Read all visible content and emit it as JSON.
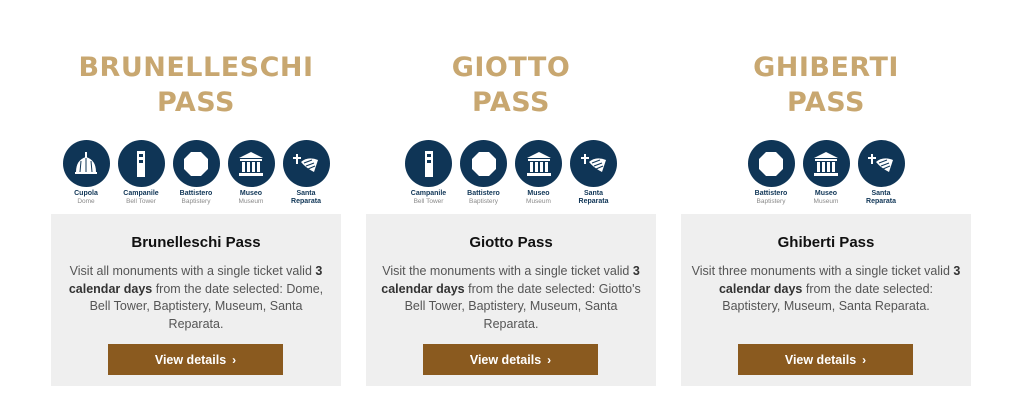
{
  "passes": [
    {
      "hero_title_line1": "BRUNELLESCHI",
      "hero_title_line2": "PASS",
      "monuments": [
        {
          "icon": "dome-icon",
          "name": "Cupola",
          "sub": "Dome"
        },
        {
          "icon": "bell-tower-icon",
          "name": "Campanile",
          "sub": "Bell Tower"
        },
        {
          "icon": "baptistery-icon",
          "name": "Battistero",
          "sub": "Baptistery"
        },
        {
          "icon": "museum-icon",
          "name": "Museo",
          "sub": "Museum"
        },
        {
          "icon": "santa-reparata-icon",
          "name": "Santa",
          "sub": "Reparata"
        }
      ],
      "title": "Brunelleschi Pass",
      "desc_pre": "Visit all monuments with a single ticket valid ",
      "desc_bold": "3 calendar days",
      "desc_post": " from the date selected: Dome, Bell Tower, Baptistery, Museum, Santa Reparata.",
      "button": "View details"
    },
    {
      "hero_title_line1": "GIOTTO",
      "hero_title_line2": "PASS",
      "monuments": [
        {
          "icon": "bell-tower-icon",
          "name": "Campanile",
          "sub": "Bell Tower"
        },
        {
          "icon": "baptistery-icon",
          "name": "Battistero",
          "sub": "Baptistery"
        },
        {
          "icon": "museum-icon",
          "name": "Museo",
          "sub": "Museum"
        },
        {
          "icon": "santa-reparata-icon",
          "name": "Santa",
          "sub": "Reparata"
        }
      ],
      "title": "Giotto Pass",
      "desc_pre": "Visit the monuments with a single ticket valid ",
      "desc_bold": "3 calendar days",
      "desc_post": " from the date selected: Giotto's Bell Tower, Baptistery, Museum, Santa Reparata.",
      "button": "View details"
    },
    {
      "hero_title_line1": "GHIBERTI",
      "hero_title_line2": "PASS",
      "monuments": [
        {
          "icon": "baptistery-icon",
          "name": "Battistero",
          "sub": "Baptistery"
        },
        {
          "icon": "museum-icon",
          "name": "Museo",
          "sub": "Museum"
        },
        {
          "icon": "santa-reparata-icon",
          "name": "Santa",
          "sub": "Reparata"
        }
      ],
      "title": "Ghiberti Pass",
      "desc_pre": "Visit three monuments with a single ticket valid ",
      "desc_bold": "3 calendar days",
      "desc_post": " from the date selected: Baptistery, Museum, Santa Reparata.",
      "button": "View details"
    }
  ],
  "colors": {
    "hero_gold": "#c8a770",
    "icon_navy": "#0f3556",
    "panel_bg": "#efefef",
    "button_brown": "#8a5a1f"
  }
}
